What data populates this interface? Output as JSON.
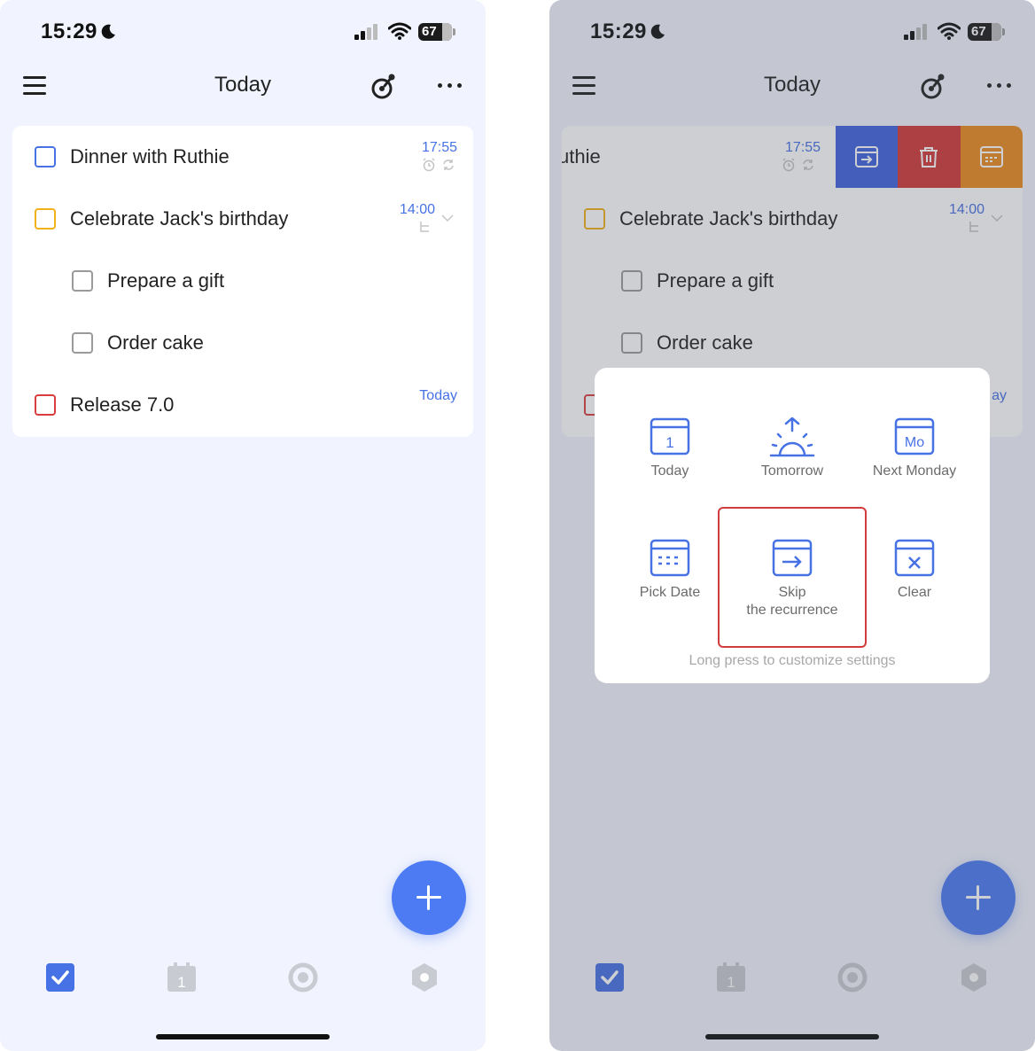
{
  "left_screen": {
    "status": {
      "time": "15:29",
      "battery": "67"
    },
    "nav": {
      "title": "Today"
    },
    "tasks": [
      {
        "title": "Dinner with Ruthie",
        "time": "17:55",
        "check_color": "#4772e6",
        "meta_icons": [
          "alarm-icon",
          "repeat-icon"
        ]
      },
      {
        "title": "Celebrate Jack's birthday",
        "time": "14:00",
        "check_color": "#f2b21c",
        "meta_icons": [
          "subtask-icon",
          "chevron-down-icon"
        ]
      },
      {
        "title": "Prepare a gift",
        "check_color": "#9a9a9a"
      },
      {
        "title": "Order cake",
        "check_color": "#9a9a9a"
      },
      {
        "title": "Release 7.0",
        "time": "Today",
        "check_color": "#d93d3d"
      }
    ],
    "tab_bar": [
      "tasks-tab",
      "calendar-tab",
      "focus-tab",
      "habit-tab"
    ],
    "calendar_tab_day": "1"
  },
  "right_screen": {
    "status": {
      "time": "15:29",
      "battery": "67"
    },
    "nav": {
      "title": "Today"
    },
    "swiped_task": {
      "title_fragment": "uthie",
      "time": "17:55"
    },
    "swipe_actions": [
      {
        "name": "skip-button",
        "color": "#3f63e0"
      },
      {
        "name": "delete-button",
        "color": "#d23a3a"
      },
      {
        "name": "date-button",
        "color": "#ea8b1f"
      }
    ],
    "tasks": [
      {
        "title": "Celebrate Jack's birthday",
        "time": "14:00"
      },
      {
        "title": "Prepare a gift"
      },
      {
        "title": "Order cake"
      }
    ],
    "release_time_fragment": "ay",
    "date_popup": {
      "options": [
        {
          "label": "Today",
          "icon": "calendar-day-icon",
          "day": "1"
        },
        {
          "label": "Tomorrow",
          "icon": "sunrise-icon"
        },
        {
          "label": "Next Monday",
          "icon": "calendar-monday-icon",
          "day": "Mo"
        },
        {
          "label": "Pick Date",
          "icon": "calendar-grid-icon"
        },
        {
          "label": "Skip",
          "label2": "the recurrence",
          "icon": "skip-icon"
        },
        {
          "label": "Clear",
          "icon": "calendar-clear-icon"
        }
      ],
      "hint": "Long press to customize settings"
    },
    "calendar_tab_day": "1"
  }
}
